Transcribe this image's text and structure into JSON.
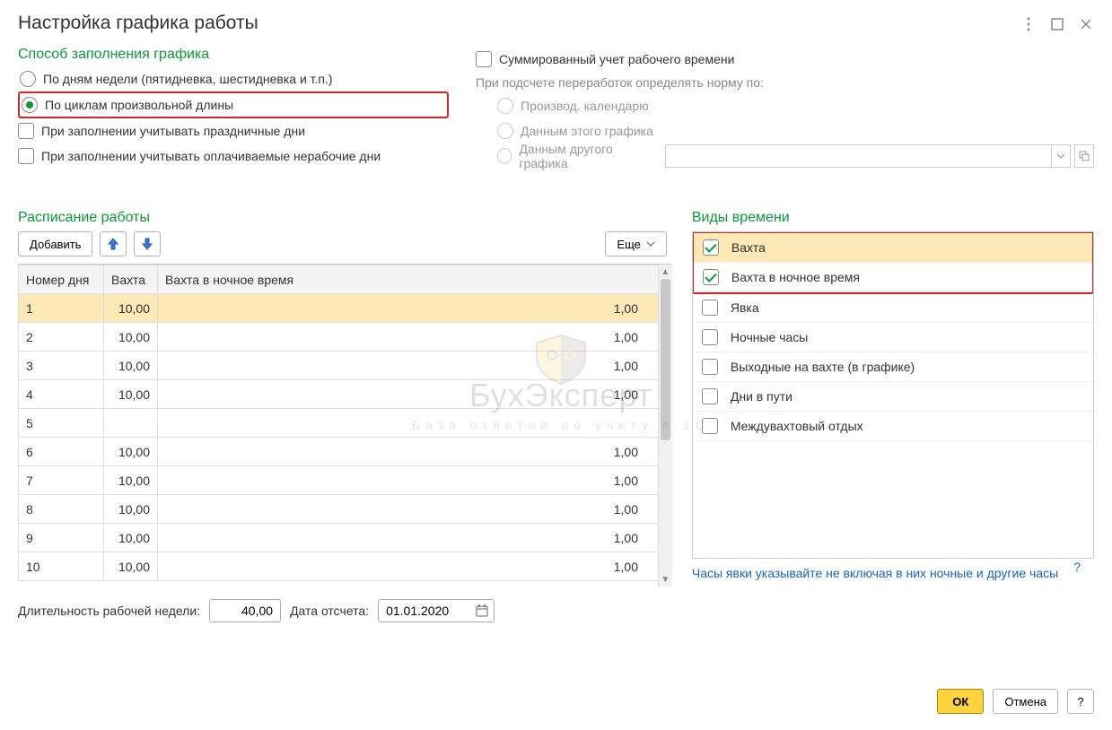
{
  "title": "Настройка графика работы",
  "method": {
    "heading": "Способ заполнения графика",
    "weekday_label": "По дням недели (пятидневка, шестидневка и т.п.)",
    "cycle_label": "По циклам произвольной длины",
    "selected": "cycle"
  },
  "options": {
    "holidays_label": "При заполнении учитывать праздничные дни",
    "paid_nonwork_label": "При заполнении учитывать оплачиваемые нерабочие дни"
  },
  "summed": {
    "checkbox_label": "Суммированный учет рабочего времени",
    "hint": "При подсчете переработок определять норму по:",
    "opt1": "Производ. календарю",
    "opt2": "Данным этого графика",
    "opt3": "Данным другого графика"
  },
  "schedule": {
    "heading": "Расписание работы",
    "add_label": "Добавить",
    "more_label": "Еще",
    "columns": {
      "day": "Номер дня",
      "shift": "Вахта",
      "night": "Вахта в ночное время"
    },
    "rows": [
      {
        "day": "1",
        "shift": "10,00",
        "night": "1,00",
        "selected": true
      },
      {
        "day": "2",
        "shift": "10,00",
        "night": "1,00"
      },
      {
        "day": "3",
        "shift": "10,00",
        "night": "1,00"
      },
      {
        "day": "4",
        "shift": "10,00",
        "night": "1,00"
      },
      {
        "day": "5",
        "shift": "",
        "night": ""
      },
      {
        "day": "6",
        "shift": "10,00",
        "night": "1,00"
      },
      {
        "day": "7",
        "shift": "10,00",
        "night": "1,00"
      },
      {
        "day": "8",
        "shift": "10,00",
        "night": "1,00"
      },
      {
        "day": "9",
        "shift": "10,00",
        "night": "1,00"
      },
      {
        "day": "10",
        "shift": "10,00",
        "night": "1,00"
      }
    ]
  },
  "week_length": {
    "label": "Длительность рабочей недели:",
    "value": "40,00"
  },
  "start_date": {
    "label": "Дата отсчета:",
    "value": "01.01.2020"
  },
  "types": {
    "heading": "Виды времени",
    "items": [
      {
        "label": "Вахта",
        "checked": true,
        "selected": true
      },
      {
        "label": "Вахта в ночное время",
        "checked": true
      },
      {
        "label": "Явка",
        "checked": false
      },
      {
        "label": "Ночные часы",
        "checked": false
      },
      {
        "label": "Выходные на вахте (в графике)",
        "checked": false
      },
      {
        "label": "Дни в пути",
        "checked": false
      },
      {
        "label": "Междувахтовый отдых",
        "checked": false
      }
    ],
    "hint": "Часы явки указывайте не включая в них ночные и другие часы"
  },
  "footer": {
    "ok": "ОК",
    "cancel": "Отмена",
    "help": "?"
  },
  "watermark": {
    "title": "БухЭксперт",
    "sub": "База ответов по учету в 1С"
  }
}
